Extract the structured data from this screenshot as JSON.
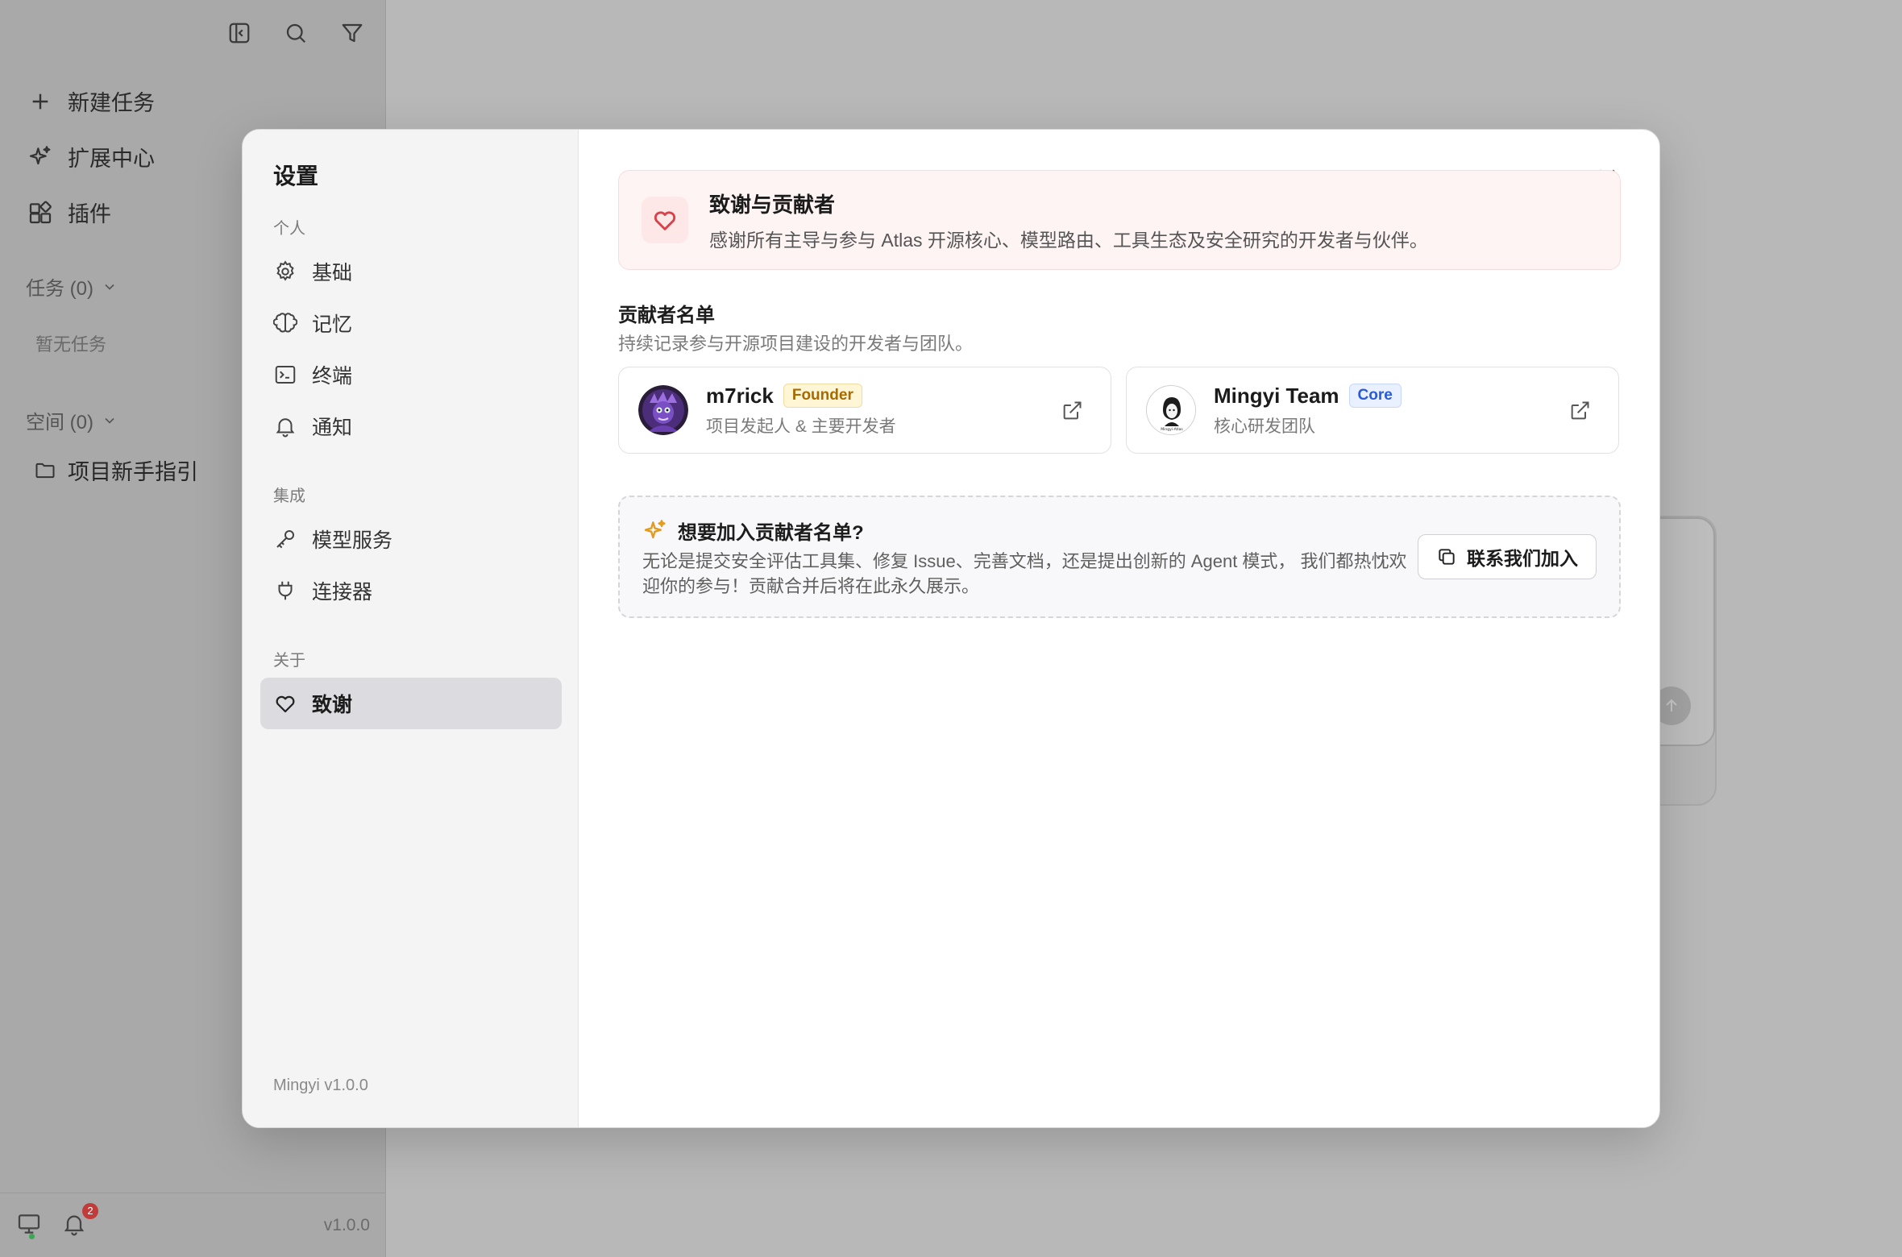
{
  "app": {
    "nav": [
      {
        "label": "新建任务",
        "icon": "plus-icon"
      },
      {
        "label": "扩展中心",
        "icon": "sparkles-icon"
      },
      {
        "label": "插件",
        "icon": "puzzle-icon"
      }
    ],
    "tasks_header": "任务 (0)",
    "tasks_empty": "暂无任务",
    "spaces_header": "空间 (0)",
    "space_item": "项目新手指引",
    "notification_count": "2",
    "version": "v1.0.0"
  },
  "settings": {
    "title": "设置",
    "groups": {
      "personal": "个人",
      "integration": "集成",
      "about": "关于"
    },
    "items": {
      "basic": "基础",
      "memory": "记忆",
      "terminal": "终端",
      "notify": "通知",
      "models": "模型服务",
      "connectors": "连接器",
      "thanks": "致谢"
    },
    "version": "Mingyi v1.0.0"
  },
  "thanks": {
    "banner_title": "致谢与贡献者",
    "banner_desc": "感谢所有主导与参与 Atlas 开源核心、模型路由、工具生态及安全研究的开发者与伙伴。",
    "list_title": "贡献者名单",
    "list_sub": "持续记录参与开源项目建设的开发者与团队。",
    "contributors": [
      {
        "name": "m7rick",
        "badge": "Founder",
        "desc": "项目发起人 & 主要开发者"
      },
      {
        "name": "Mingyi Team",
        "badge": "Core",
        "desc": "核心研发团队"
      }
    ],
    "join_title": "想要加入贡献者名单?",
    "join_desc": "无论是提交安全评估工具集、修复 Issue、完善文档，还是提出创新的 Agent 模式， 我们都热忱欢迎你的参与！贡献合并后将在此永久展示。",
    "join_button": "联系我们加入"
  },
  "colors": {
    "accent_red": "#d9404a",
    "founder_badge": "#a76a00",
    "core_badge": "#2a5bd7",
    "sparkle": "#e39b1f"
  }
}
